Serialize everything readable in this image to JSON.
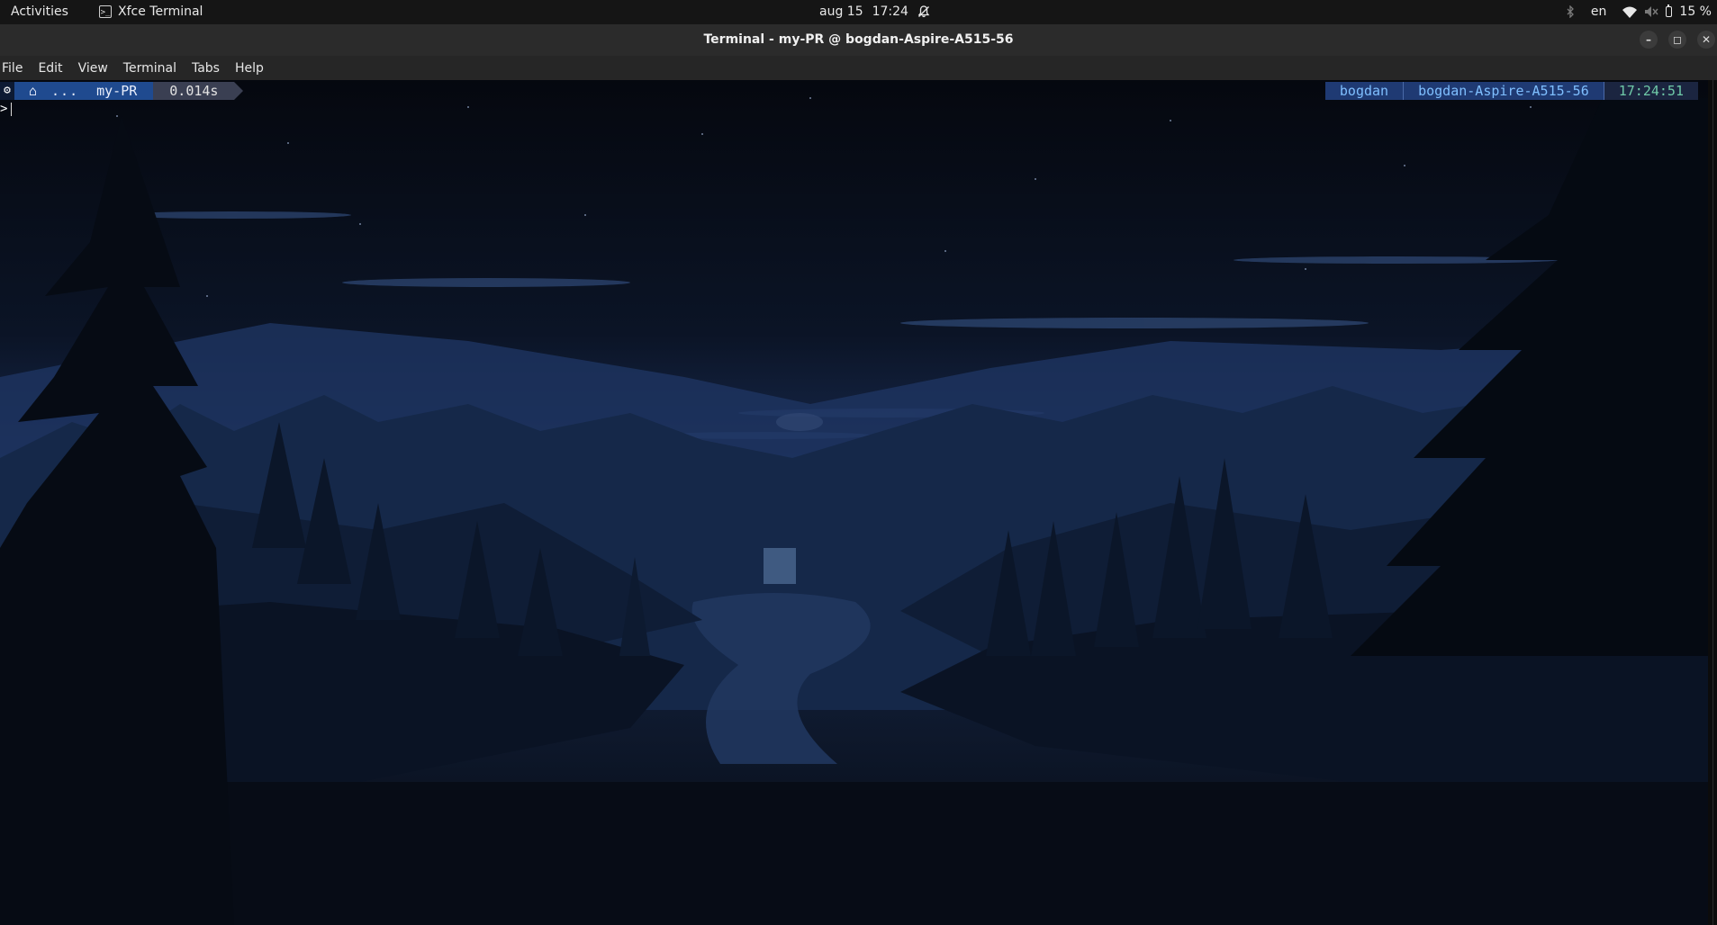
{
  "topbar": {
    "activities": "Activities",
    "app_name": "Xfce Terminal",
    "app_icon_glyph": ">_",
    "date": "aug 15",
    "time": "17:24",
    "language": "en",
    "battery": "15 %",
    "icons": [
      "notifications-off-icon",
      "bluetooth-icon",
      "wifi-icon",
      "volume-muted-icon",
      "battery-icon"
    ]
  },
  "window": {
    "title": "Terminal - my-PR @ bogdan-Aspire-A515-56",
    "minimize_glyph": "–",
    "maximize_glyph": "◻",
    "close_glyph": "✕"
  },
  "menubar": {
    "items": [
      "File",
      "Edit",
      "View",
      "Terminal",
      "Tabs",
      "Help"
    ]
  },
  "prompt": {
    "os_glyph": "⚙",
    "home_glyph": "⌂",
    "ellipsis": "...",
    "directory": "my-PR",
    "exec_time": "0.014s",
    "user": "bogdan",
    "host": "bogdan-Aspire-A515-56",
    "clock": "17:24:51",
    "caret": ">"
  },
  "colors": {
    "prompt_blue": "#1f4a8f",
    "prompt_grey": "#3a3f52",
    "right_text": "#7fbfff",
    "clock_text": "#6fc9a8",
    "sky_mid": "#223a66"
  }
}
